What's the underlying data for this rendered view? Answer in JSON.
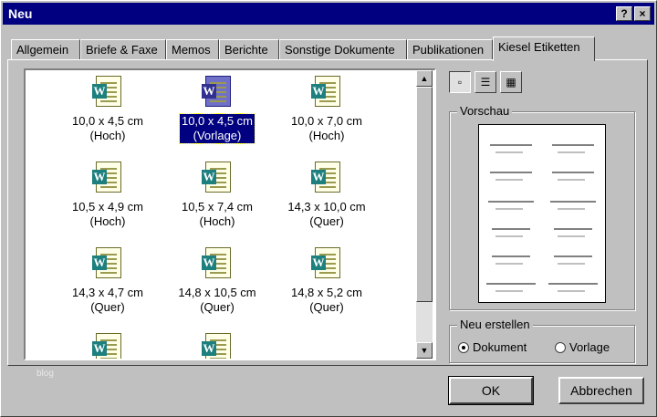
{
  "window": {
    "title": "Neu",
    "help_label": "?",
    "close_label": "×"
  },
  "tabs": [
    {
      "label": "Allgemein"
    },
    {
      "label": "Briefe & Faxe"
    },
    {
      "label": "Memos"
    },
    {
      "label": "Berichte"
    },
    {
      "label": "Sonstige Dokumente"
    },
    {
      "label": "Publikationen"
    },
    {
      "label": "Kiesel Etiketten",
      "active": true
    }
  ],
  "templates": [
    {
      "size": "10,0 x 4,5 cm",
      "orient": "(Hoch)"
    },
    {
      "size": "10,0 x 4,5 cm",
      "orient": "(Vorlage)",
      "selected": true
    },
    {
      "size": "10,0 x 7,0 cm",
      "orient": "(Hoch)"
    },
    {
      "size": "10,5 x 4,9 cm",
      "orient": "(Hoch)"
    },
    {
      "size": "10,5 x 7,4 cm",
      "orient": "(Hoch)"
    },
    {
      "size": "14,3 x 10,0 cm",
      "orient": "(Quer)"
    },
    {
      "size": "14,3 x 4,7 cm",
      "orient": "(Quer)"
    },
    {
      "size": "14,8 x 10,5 cm",
      "orient": "(Quer)"
    },
    {
      "size": "14,8 x 5,2 cm",
      "orient": "(Quer)"
    }
  ],
  "icon_letter": "W",
  "scroll": {
    "up": "▲",
    "down": "▼"
  },
  "view_buttons": [
    {
      "icon": "large-icons-view-icon",
      "glyph": "▫",
      "active": true
    },
    {
      "icon": "list-view-icon",
      "glyph": "☰"
    },
    {
      "icon": "details-view-icon",
      "glyph": "▦"
    }
  ],
  "preview": {
    "legend": "Vorschau"
  },
  "create_new": {
    "legend": "Neu erstellen",
    "options": [
      {
        "label": "Dokument",
        "checked": true
      },
      {
        "label": "Vorlage",
        "checked": false
      }
    ]
  },
  "buttons": {
    "ok": "OK",
    "cancel": "Abbrechen"
  },
  "watermark": "blog"
}
